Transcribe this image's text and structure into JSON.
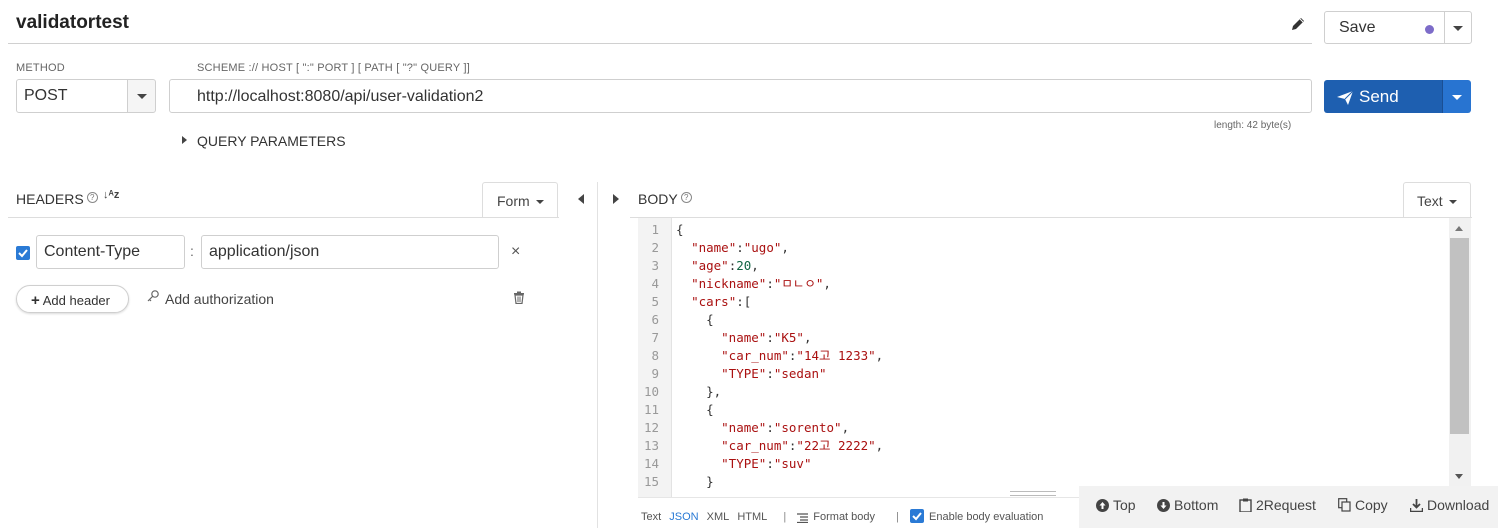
{
  "request": {
    "name": "validatortest",
    "save_label": "Save",
    "method_label": "METHOD",
    "method_value": "POST",
    "scheme_label": "SCHEME :// HOST [ \":\" PORT ] [ PATH [ \"?\" QUERY ]]",
    "url": "http://localhost:8080/api/user-validation2",
    "length": "length: 42 byte(s)",
    "send_label": "Send",
    "query_params_label": "QUERY PARAMETERS",
    "accent_color": "#1e5fb0",
    "save_dot_color": "#7d6cc9"
  },
  "headers": {
    "label": "HEADERS",
    "help_icon": "?",
    "sort_icon": "↓ᴬᴢ",
    "mode": "Form",
    "rows": [
      {
        "enabled": true,
        "key": "Content-Type",
        "separator": ":",
        "value": "application/json"
      }
    ],
    "add_header_label": "Add header",
    "add_authorization_label": "Add authorization"
  },
  "body": {
    "label": "BODY",
    "help_icon": "?",
    "mode": "Text",
    "line_numbers": [
      "1",
      "2",
      "3",
      "4",
      "5",
      "6",
      "7",
      "8",
      "9",
      "10",
      "11",
      "12",
      "13",
      "14",
      "15"
    ],
    "formats": [
      "Text",
      "JSON",
      "XML",
      "HTML"
    ],
    "active_format": "JSON",
    "format_body_label": "Format body",
    "enable_evaluation_label": "Enable body evaluation",
    "enable_evaluation": true,
    "separator": "|"
  },
  "footer": {
    "top": "Top",
    "bottom": "Bottom",
    "to_request": "2Request",
    "copy": "Copy",
    "download": "Download"
  }
}
